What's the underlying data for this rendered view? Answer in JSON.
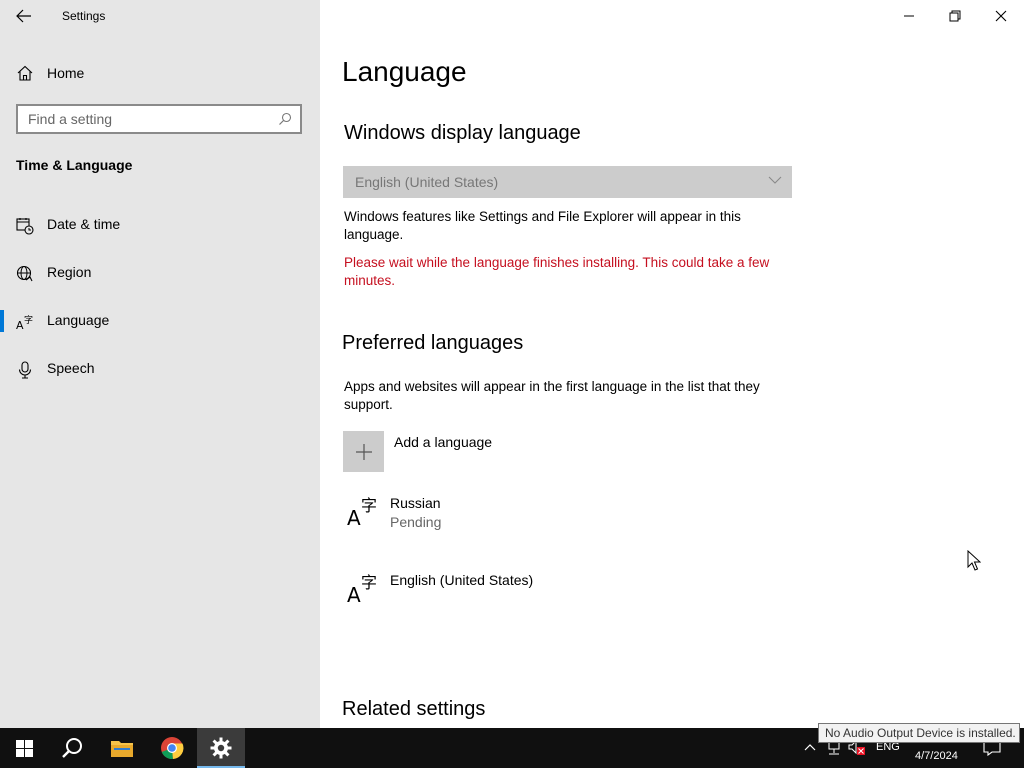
{
  "window": {
    "title": "Settings"
  },
  "sidebar": {
    "home_label": "Home",
    "search_placeholder": "Find a setting",
    "section_title": "Time & Language",
    "items": [
      {
        "label": "Date & time",
        "icon": "calendar-clock-icon"
      },
      {
        "label": "Region",
        "icon": "globe-icon"
      },
      {
        "label": "Language",
        "icon": "language-icon",
        "selected": true
      },
      {
        "label": "Speech",
        "icon": "microphone-icon"
      }
    ],
    "accent_color": "#0078d7"
  },
  "main": {
    "page_title": "Language",
    "display_language": {
      "heading": "Windows display language",
      "selected_value": "English (United States)",
      "description": "Windows features like Settings and File Explorer will appear in this language.",
      "warning": "Please wait while the language finishes installing. This could take a few minutes.",
      "warning_color": "#c50f1f"
    },
    "preferred": {
      "heading": "Preferred languages",
      "description": "Apps and websites will appear in the first language in the list that they support.",
      "add_label": "Add a language",
      "languages": [
        {
          "name": "Russian",
          "status": "Pending"
        },
        {
          "name": "English (United States)",
          "status": ""
        }
      ]
    },
    "related_heading": "Related settings"
  },
  "taskbar": {
    "ime": "ENG",
    "date": "4/7/2024",
    "tooltip": "No Audio Output Device is installed."
  }
}
